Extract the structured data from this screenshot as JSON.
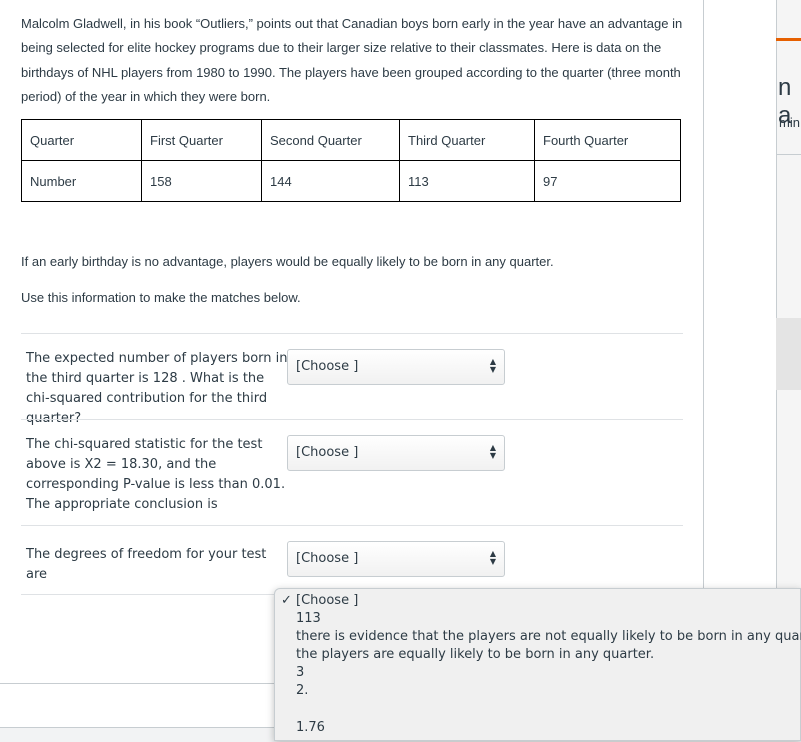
{
  "intro": "Malcolm Gladwell, in his book “Outliers,” points out that Canadian boys born early in the year have an advantage in being selected for elite hockey programs due to their larger size relative to their classmates.  Here is data on the birthdays of NHL players from 1980 to 1990.  The players have been grouped according to the quarter (three month period) of the year in which they were born.",
  "table": {
    "headers": [
      "Quarter",
      "First Quarter",
      "Second Quarter",
      "Third Quarter",
      "Fourth Quarter"
    ],
    "row": [
      "Number",
      "158",
      "144",
      "113",
      "97"
    ]
  },
  "para1": "If an early birthday is no advantage, players would be equally likely to be born in any quarter.",
  "para2": "Use this information to make the matches below.",
  "questions": [
    {
      "text": "The expected number of players born in the third quarter is 128 . What is the chi-squared contribution for the third quarter?",
      "selected": "[Choose ]"
    },
    {
      "text": "The chi-squared statistic for the test above is X2 = 18.30, and the corresponding P-value is less than 0.01. The appropriate conclusion is",
      "selected": "[Choose ]"
    },
    {
      "text": "The degrees of freedom for your test are",
      "selected": "[Choose ]"
    }
  ],
  "dropdown": {
    "checkmark": "✓",
    "options": [
      "[Choose ]",
      "113",
      "there is evidence that the players are not equally likely to be born in any quarter.",
      "the players are equally likely to be born in any quarter.",
      "3",
      "2.",
      "",
      "1.76"
    ]
  },
  "edge": {
    "letter": "n a",
    "min": "min"
  },
  "colors": {
    "accent": "#e66000",
    "text": "#2d3b45",
    "border": "#c7cdd1"
  }
}
